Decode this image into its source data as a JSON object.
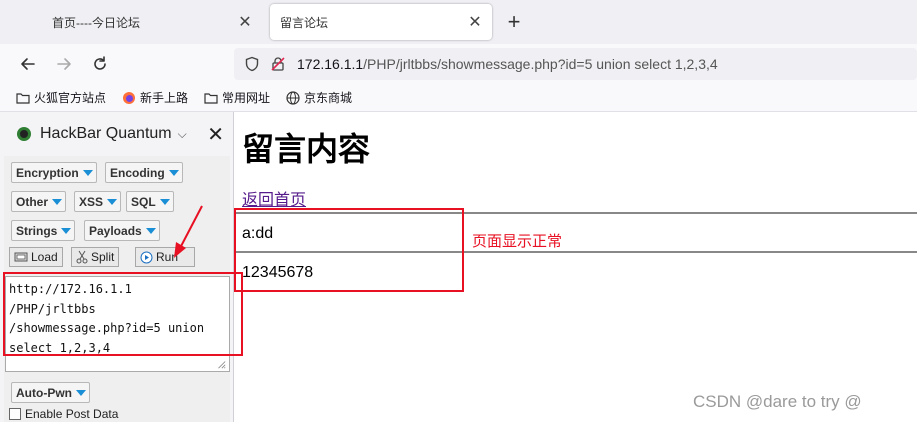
{
  "tabs": [
    {
      "label": "首页----今日论坛",
      "active": false
    },
    {
      "label": "留言论坛",
      "active": true
    }
  ],
  "nav": {
    "url_host": "172.16.1.1",
    "url_rest": "/PHP/jrltbbs/showmessage.php?id=5 union select 1,2,3,4"
  },
  "bookmarks": [
    {
      "label": "火狐官方站点",
      "icon": "folder-icon"
    },
    {
      "label": "新手上路",
      "icon": "firefox-icon"
    },
    {
      "label": "常用网址",
      "icon": "folder-icon"
    },
    {
      "label": "京东商城",
      "icon": "globe-icon"
    }
  ],
  "hackbar": {
    "title": "HackBar Quantum",
    "menus": [
      "Encryption",
      "Encoding",
      "Other",
      "XSS",
      "SQL",
      "Strings",
      "Payloads"
    ],
    "actions": {
      "load": "Load",
      "split": "Split",
      "run": "Run"
    },
    "url_lines": "http://172.16.1.1\n/PHP/jrltbbs\n/showmessage.php?id=5 union\nselect 1,2,3,4",
    "autopwn": "Auto-Pwn",
    "post_label": "Enable Post Data",
    "post_checked": false
  },
  "page": {
    "title": "留言内容",
    "back_link": "返回首页",
    "message_title": "a:dd",
    "message_body": "12345678"
  },
  "annotation": {
    "note": "页面显示正常",
    "color": "#e81123"
  },
  "watermark": "CSDN @dare to try @"
}
